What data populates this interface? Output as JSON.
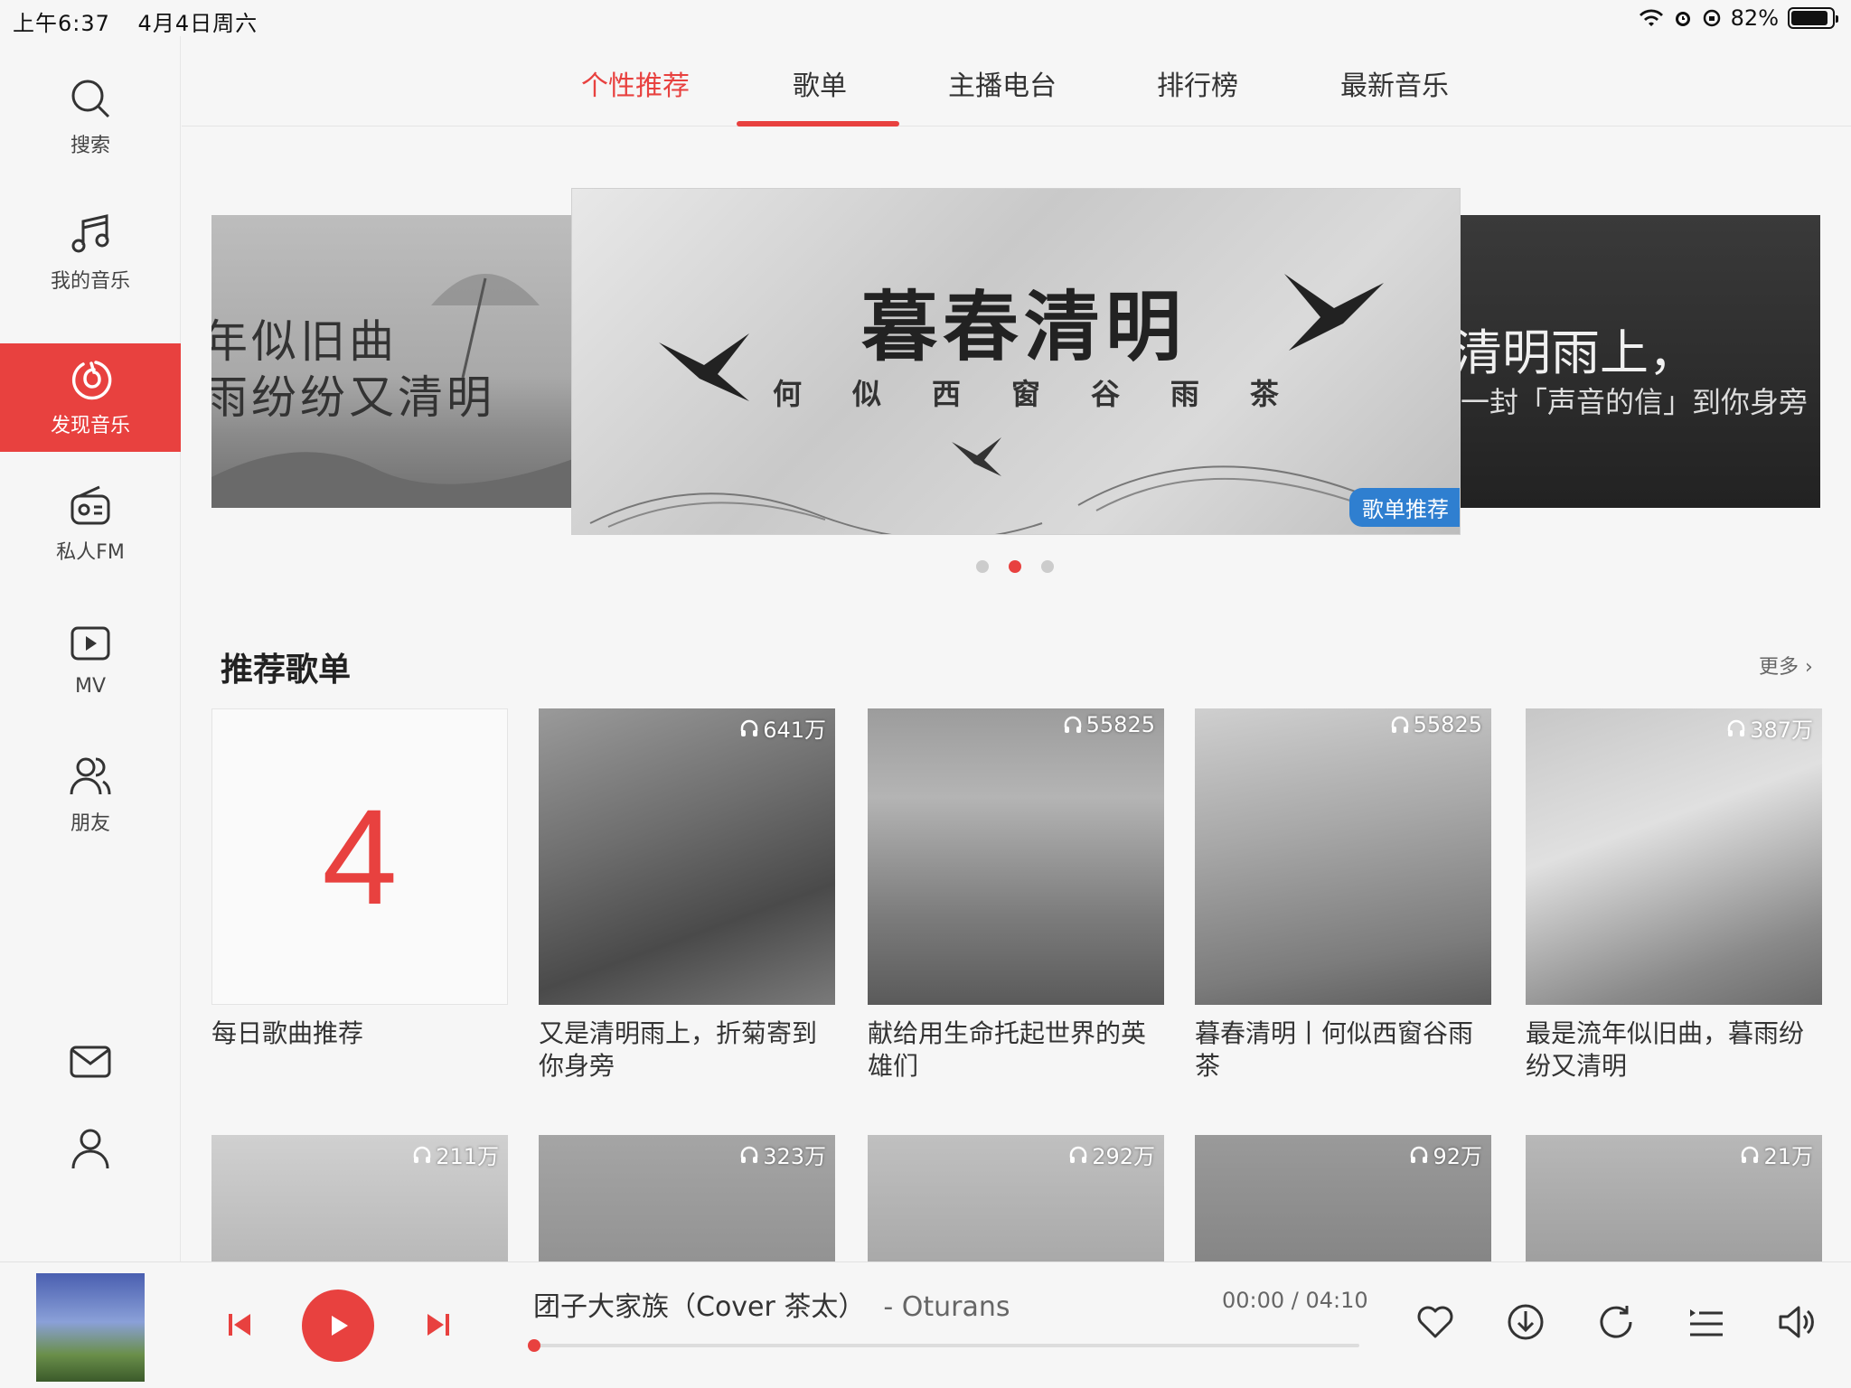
{
  "status_bar": {
    "time": "上午6:37",
    "date": "4月4日周六",
    "battery": "82%"
  },
  "sidebar": {
    "items": [
      {
        "label": "搜索",
        "icon": "search-icon"
      },
      {
        "label": "我的音乐",
        "icon": "music-note-icon"
      },
      {
        "label": "发现音乐",
        "icon": "netease-logo-icon",
        "active": true
      },
      {
        "label": "私人FM",
        "icon": "radio-icon"
      },
      {
        "label": "MV",
        "icon": "video-play-icon"
      },
      {
        "label": "朋友",
        "icon": "friends-icon"
      }
    ],
    "bottom": [
      {
        "icon": "mail-icon"
      },
      {
        "icon": "user-icon"
      }
    ]
  },
  "tabs": [
    {
      "label": "个性推荐",
      "active": true
    },
    {
      "label": "歌单"
    },
    {
      "label": "主播电台"
    },
    {
      "label": "排行榜"
    },
    {
      "label": "最新音乐"
    }
  ],
  "banner": {
    "left": {
      "line1": "年似旧曲",
      "line2": "雨纷纷又清明"
    },
    "center": {
      "title": "暮春清明",
      "subtitle": [
        "何",
        "似",
        "西",
        "窗",
        "谷",
        "雨",
        "茶"
      ],
      "tag": "歌单推荐"
    },
    "right": {
      "line1": "清明雨上，",
      "line2": "一封「声音的信」到你身旁"
    },
    "dots": 3,
    "active_dot": 1
  },
  "section": {
    "title": "推荐歌单",
    "more": "更多"
  },
  "playlists": [
    {
      "name": "每日歌曲推荐",
      "daily_number": "4",
      "plays": ""
    },
    {
      "name": "又是清明雨上，折菊寄到你身旁",
      "plays": "641万"
    },
    {
      "name": "献给用生命托起世界的英雄们",
      "plays": "55825"
    },
    {
      "name": "暮春清明丨何似西窗谷雨茶",
      "plays": "55825"
    },
    {
      "name": "最是流年似旧曲，暮雨纷纷又清明",
      "plays": "387万"
    }
  ],
  "playlists_row2": [
    {
      "plays": "211万"
    },
    {
      "plays": "323万"
    },
    {
      "plays": "292万"
    },
    {
      "plays": "92万"
    },
    {
      "plays": "21万"
    }
  ],
  "player": {
    "song": "团子大家族（Cover 茶太）",
    "artist": "- Oturans",
    "current": "00:00",
    "duration": "04:10",
    "time_display": "00:00 / 04:10",
    "progress": 0
  },
  "colors": {
    "accent": "#e8413f",
    "tag_blue": "#2f7fd0"
  }
}
